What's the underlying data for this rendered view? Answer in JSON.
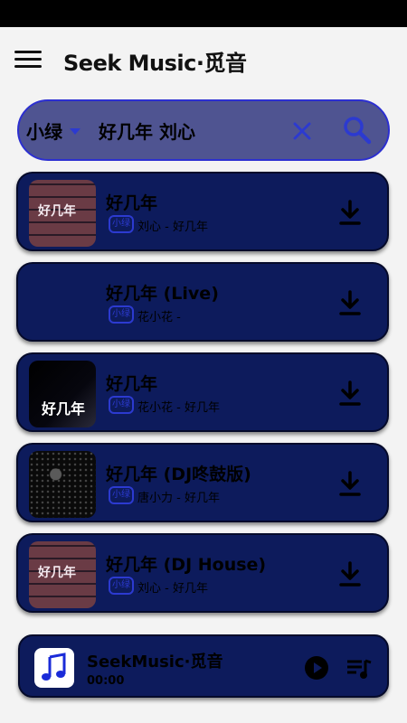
{
  "app": {
    "title": "Seek Music·觅音"
  },
  "search": {
    "source": "小绿",
    "query": "好几年 刘心"
  },
  "songs": [
    {
      "title": "好几年",
      "badge": "小绿",
      "meta": "刘心 - 好几年",
      "cover": "brick",
      "cover_text": "好几年"
    },
    {
      "title": "好几年 (Live)",
      "badge": "小绿",
      "meta": "花小花 -",
      "cover": "none",
      "cover_text": ""
    },
    {
      "title": "好几年",
      "badge": "小绿",
      "meta": "花小花 - 好几年",
      "cover": "dark",
      "cover_text": "好几年"
    },
    {
      "title": "好几年 (DJ咚鼓版)",
      "badge": "小绿",
      "meta": "唐小力 - 好几年",
      "cover": "dots",
      "cover_text": ""
    },
    {
      "title": "好几年 (DJ House)",
      "badge": "小绿",
      "meta": "刘心 - 好几年",
      "cover": "brick",
      "cover_text": "好几年"
    }
  ],
  "player": {
    "title": "SeekMusic·觅音",
    "time": "00:00",
    "art_icon": "music-note-icon"
  },
  "colors": {
    "card": "#0d1b5c",
    "accent": "#2c3ad0",
    "search_bg": "#4f5491"
  }
}
